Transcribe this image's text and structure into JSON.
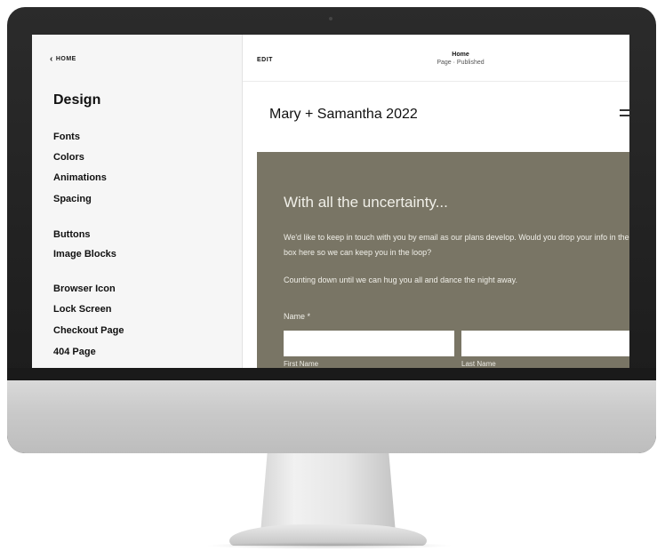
{
  "left_panel": {
    "back_label": "HOME",
    "title": "Design",
    "groups": [
      [
        "Fonts",
        "Colors",
        "Animations",
        "Spacing"
      ],
      [
        "Buttons",
        "Image Blocks"
      ],
      [
        "Browser Icon",
        "Lock Screen",
        "Checkout Page",
        "404 Page"
      ]
    ]
  },
  "editor": {
    "edit_label": "EDIT",
    "page_name": "Home",
    "page_status": "Page · Published",
    "site_title": "Mary + Samantha 2022"
  },
  "section": {
    "heading": "With all the uncertainty...",
    "paragraph_1": "We'd like to keep in touch with you by email as our plans develop. Would you drop your info in the box here so we can keep you in the loop?",
    "paragraph_2": "Counting down until we can hug you all and dance the night away.",
    "name_label": "Name *",
    "first_name_value": "",
    "last_name_value": "",
    "first_name_sublabel": "First Name",
    "last_name_sublabel": "Last Name"
  },
  "colors": {
    "section_background": "#797565",
    "section_text": "#f0efe8",
    "panel_background": "#f6f6f6"
  }
}
